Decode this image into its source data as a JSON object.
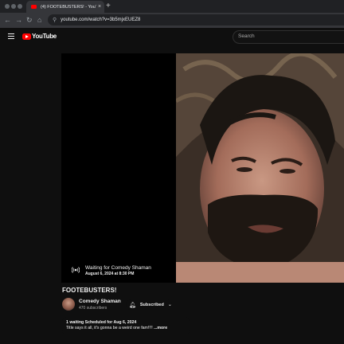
{
  "browser": {
    "tab_title": "(4) FOOTEBUSTERS! - YouTube",
    "tab_close": "×",
    "new_tab": "+",
    "url": "youtube.com/watch?v=3b5mjxEUEZ8",
    "nav": {
      "back": "←",
      "forward": "→",
      "reload": "↻",
      "home": "⌂"
    }
  },
  "header": {
    "logo_text": "YouTube",
    "search_placeholder": "Search"
  },
  "player": {
    "waiting_title": "Waiting for Comedy Shaman",
    "scheduled_time": "August 6, 2024 at 8:30 PM"
  },
  "video": {
    "title": "FOOTEBUSTERS!",
    "channel_name": "Comedy Shaman",
    "subscribers": "470 subscribers",
    "subscribe_label": "Subscribed",
    "description_meta": "1 waiting  Scheduled for Aug 6, 2024",
    "description_text": "Title says it all, it's gonna be a weird one fam!!!! ",
    "more_label": "...more"
  },
  "colors": {
    "brand": "#ff0000",
    "background": "#0f0f0f",
    "chrome": "#35363a"
  },
  "icons": [
    "youtube-favicon",
    "menu-icon",
    "youtube-logo-icon",
    "live-broadcast-icon",
    "bell-icon",
    "chevron-down-icon",
    "site-settings-icon"
  ]
}
